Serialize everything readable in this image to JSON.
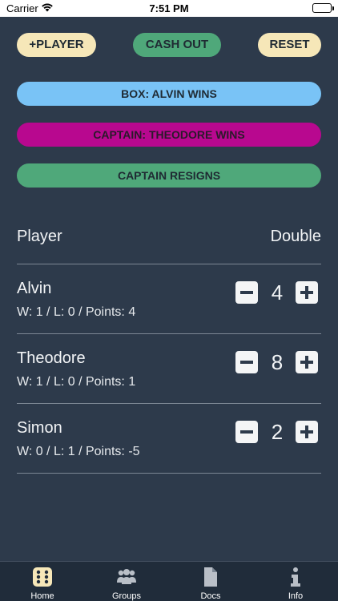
{
  "status_bar": {
    "carrier": "Carrier",
    "time": "7:51 PM"
  },
  "actions": {
    "add_player": "+PLAYER",
    "cash_out": "CASH OUT",
    "reset": "RESET",
    "box_wins": "BOX: ALVIN WINS",
    "captain_wins": "CAPTAIN: THEODORE WINS",
    "captain_resigns": "CAPTAIN RESIGNS"
  },
  "table": {
    "header_player": "Player",
    "header_double": "Double",
    "rows": [
      {
        "name": "Alvin",
        "stats": "W: 1 / L: 0 / Points: 4",
        "double": "4"
      },
      {
        "name": "Theodore",
        "stats": "W: 1 / L: 0 / Points: 1",
        "double": "8"
      },
      {
        "name": "Simon",
        "stats": "W: 0 / L: 1 / Points: -5",
        "double": "2"
      }
    ]
  },
  "tab_bar": {
    "tabs": [
      {
        "label": "Home",
        "icon": "dice-icon"
      },
      {
        "label": "Groups",
        "icon": "users-icon"
      },
      {
        "label": "Docs",
        "icon": "document-icon"
      },
      {
        "label": "Info",
        "icon": "info-icon"
      }
    ]
  },
  "colors": {
    "background": "#2d3a4b",
    "cream": "#f6e7b8",
    "green": "#4fa87a",
    "blue": "#79c3f6",
    "magenta": "#b8088f"
  }
}
